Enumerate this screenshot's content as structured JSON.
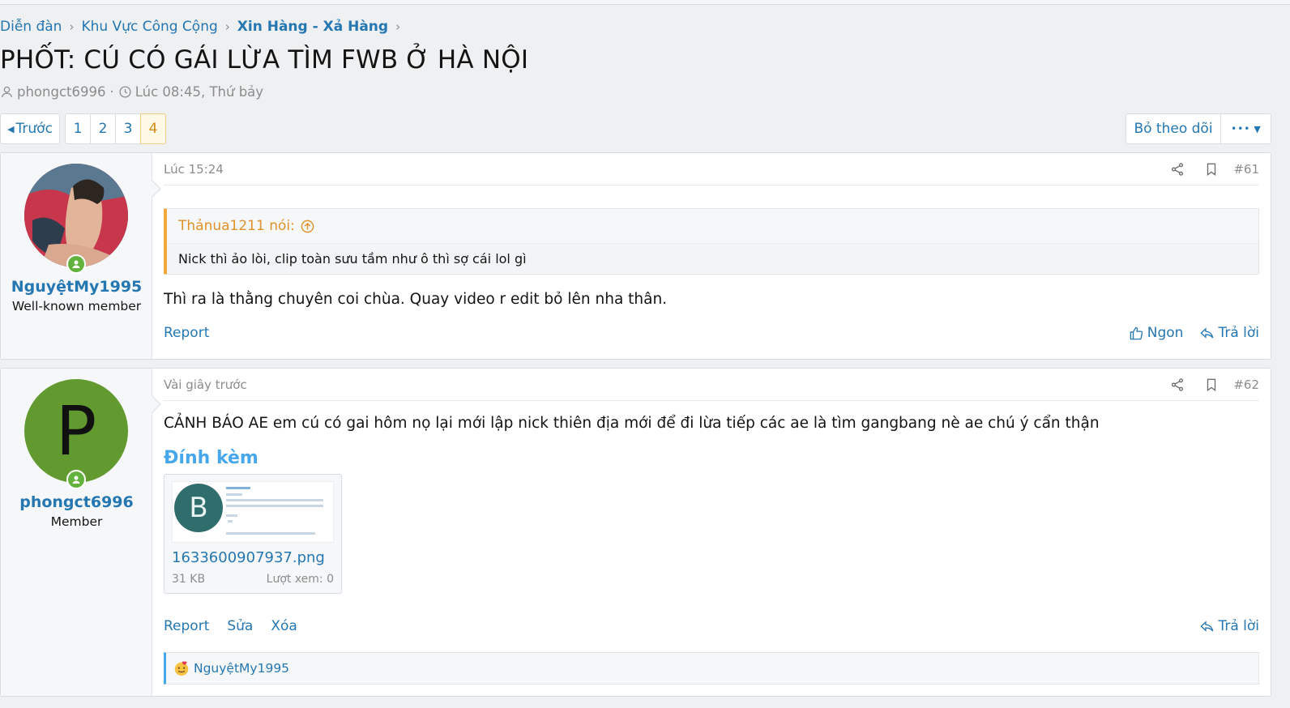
{
  "breadcrumb": {
    "items": [
      {
        "label": "Diễn đàn"
      },
      {
        "label": "Khu Vực Công Cộng"
      },
      {
        "label": "Xin Hàng - Xả Hàng"
      }
    ]
  },
  "thread": {
    "title": "PHỐT: CÚ CÓ GÁI LỪA TÌM FWB Ở HÀ NỘI",
    "author": "phongct6996",
    "separator": "·",
    "started": "Lúc 08:45, Thứ bảy"
  },
  "pagination": {
    "prev_label": "Trước",
    "pages": [
      "1",
      "2",
      "3",
      "4"
    ],
    "current": "4"
  },
  "toolbar": {
    "follow_label": "Bỏ theo dõi",
    "more_label": "•••"
  },
  "posts": [
    {
      "username": "NguyệtMy1995",
      "user_title": "Well-known member",
      "time": "Lúc 15:24",
      "number": "#61",
      "quote": {
        "author_line": "Thảnua1211 nói:",
        "text": "Nick thì ảo lòi, clip toàn sưu tầm như ô thì sợ cái lol gì"
      },
      "text": "Thì ra là thằng chuyên coi chùa. Quay video r edit bỏ lên nha thân.",
      "actions_left": [
        "Report"
      ],
      "like_label": "Ngon",
      "reply_label": "Trả lời"
    },
    {
      "username": "phongct6996",
      "avatar_letter": "P",
      "user_title": "Member",
      "time": "Vài giây trước",
      "number": "#62",
      "text": "CẢNH BÁO AE em cú có gai hôm nọ lại mới lập nick thiên địa mới để đi lừa tiếp các ae là tìm gangbang nè ae chú ý cẩn thận",
      "attachments_title": "Đính kèm",
      "attachment": {
        "thumb_letter": "B",
        "filename": "1633600907937.png",
        "size": "31 KB",
        "views": "Lượt xem: 0"
      },
      "actions_left": [
        "Report",
        "Sửa",
        "Xóa"
      ],
      "reply_label": "Trả lời",
      "reaction_user": "NguyệtMy1995"
    }
  ],
  "colors": {
    "link": "#2577b1",
    "quote_accent": "#f0a938",
    "online": "#63b23d",
    "current_page_bg": "#fef8e6"
  }
}
